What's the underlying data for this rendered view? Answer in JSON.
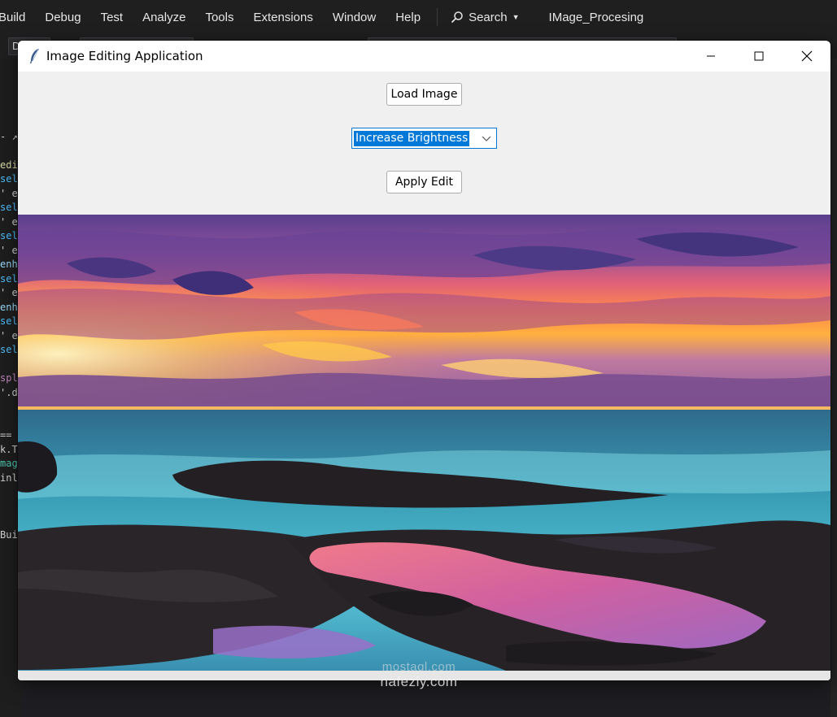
{
  "vs": {
    "menu": [
      "Build",
      "Debug",
      "Test",
      "Analyze",
      "Tools",
      "Extensions",
      "Window",
      "Help"
    ],
    "search_label": "Search",
    "project_name": "IMage_Procesing",
    "toolbar_box_label": "D",
    "code_fragments": [
      "",
      "",
      "",
      "",
      "",
      "- ↗",
      "",
      "edit",
      "sel",
      "' ed",
      "sel",
      "' ed",
      "sel",
      "' ed",
      "enh",
      "sel",
      "' ed",
      "enh",
      "sel",
      "' ed",
      "sel",
      "",
      "spl",
      "'.di",
      "",
      "",
      "==",
      "k.T",
      "mage",
      "inlo",
      "",
      "",
      "",
      "Buil"
    ]
  },
  "window": {
    "title": "Image Editing Application",
    "icon": "feather-icon"
  },
  "controls": {
    "load_button": "Load Image",
    "edit_select": {
      "selected": "Increase Brightness"
    },
    "apply_button": "Apply Edit"
  },
  "image": {
    "description_icon": "sunset-seascape-image"
  },
  "watermark": {
    "line1": "mostaql.com",
    "line2": "nafezly.com"
  }
}
